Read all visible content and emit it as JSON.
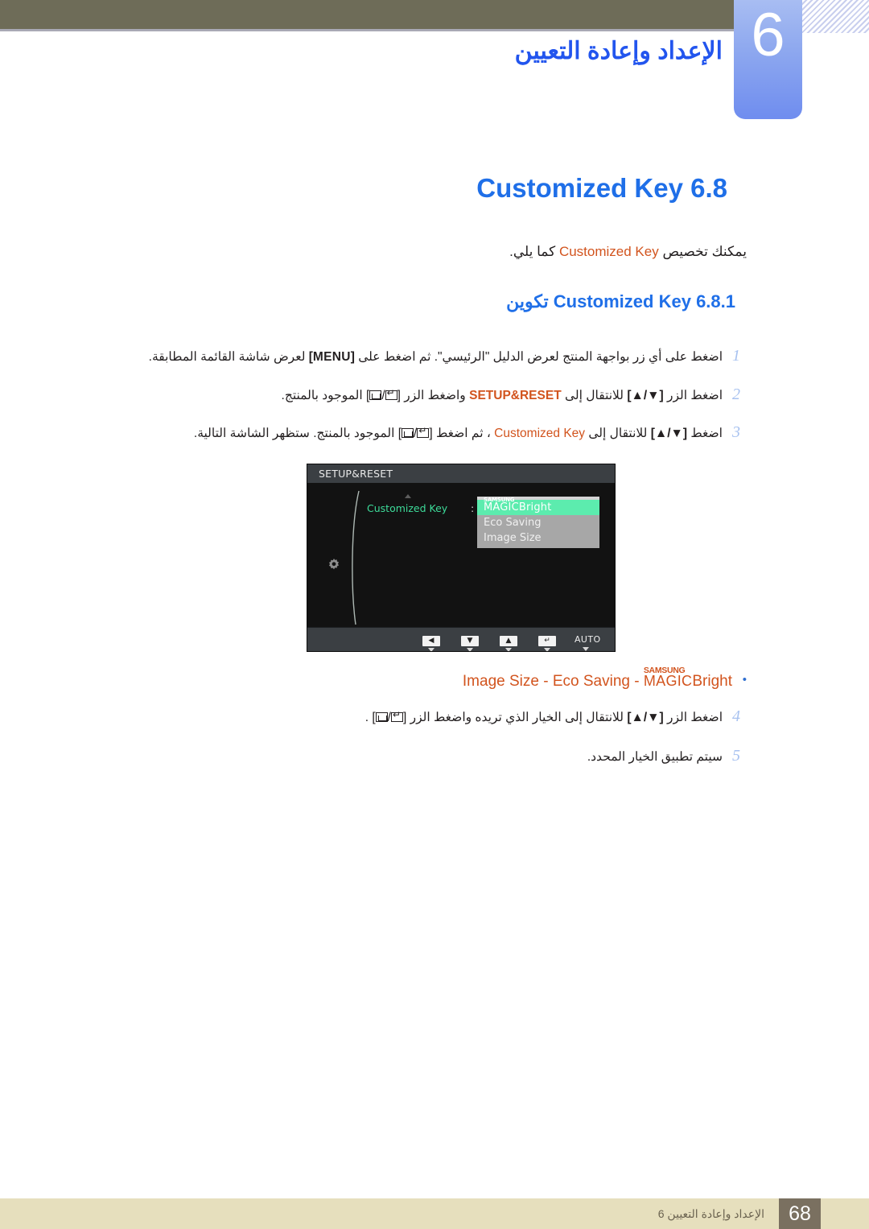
{
  "header": {
    "chapter_number": "6",
    "title": "الإعداد وإعادة التعيين"
  },
  "section": {
    "number": "6.8",
    "title_ltr": "Customized Key",
    "intro_before": "يمكنك تخصيص",
    "intro_highlight": "Customized Key",
    "intro_after": "كما يلي."
  },
  "subsection": {
    "number": "6.8.1",
    "title_ar": "تكوين",
    "title_ltr": "Customized Key"
  },
  "steps": [
    {
      "num": "1",
      "part_a": "اضغط على أي زر بواجهة المنتج لعرض الدليل \"الرئيسي\". ثم اضغط على",
      "kbd": "[MENU]",
      "part_b": "لعرض شاشة القائمة المطابقة."
    },
    {
      "num": "2",
      "part_a": "اضغط الزر",
      "kbd1": "[▲/▼]",
      "part_b": "للانتقال إلى",
      "highlight": "SETUP&RESET",
      "part_c": "واضغط الزر",
      "kbd2": "[   /   ]",
      "part_d": "الموجود بالمنتج."
    },
    {
      "num": "3",
      "part_a": "اضغط",
      "kbd1": "[▲/▼]",
      "part_b": "للانتقال إلى",
      "highlight": "Customized Key",
      "part_c": "، ثم اضغط",
      "kbd2": "[   /   ]",
      "part_d": "الموجود بالمنتج. ستظهر الشاشة التالية."
    },
    {
      "num": "4",
      "part_a": "اضغط الزر",
      "kbd1": "[▲/▼]",
      "part_b": "للانتقال إلى الخيار الذي تريده واضغط الزر",
      "kbd2": "[   /   ]",
      "part_d": "."
    },
    {
      "num": "5",
      "part_a": "سيتم تطبيق الخيار المحدد."
    }
  ],
  "osd": {
    "title": "SETUP&RESET",
    "row_label": "Customized Key",
    "colon": ":",
    "menu_items": [
      {
        "samsung": "SAMSUNG",
        "magic": "MAGIC",
        "suffix": "Bright",
        "selected": true
      },
      {
        "label": "Eco Saving",
        "selected": false
      },
      {
        "label": "Image Size",
        "selected": false
      }
    ],
    "buttons": [
      {
        "name": "left-arrow",
        "glyph": "◀"
      },
      {
        "name": "down-arrow",
        "glyph": "▼"
      },
      {
        "name": "up-arrow",
        "glyph": "▲"
      },
      {
        "name": "enter",
        "glyph": "↵"
      },
      {
        "name": "auto",
        "text": "AUTO"
      },
      {
        "name": "power",
        "text": "⏻"
      }
    ]
  },
  "bullet": {
    "dot": "•",
    "samsung": "SAMSUNG",
    "magic": "MAGIC",
    "bright": "Bright",
    "rest": "Image Size - Eco Saving - "
  },
  "footer": {
    "page_number": "68",
    "text": "الإعداد وإعادة التعيين 6"
  },
  "colors": {
    "heading_blue": "#1f6fe8",
    "highlight_orange": "#d2541e",
    "olive": "#6e6c58",
    "footer_beige": "#e6dfbd",
    "footer_box": "#7a7060",
    "osd_green": "#5cecae"
  }
}
